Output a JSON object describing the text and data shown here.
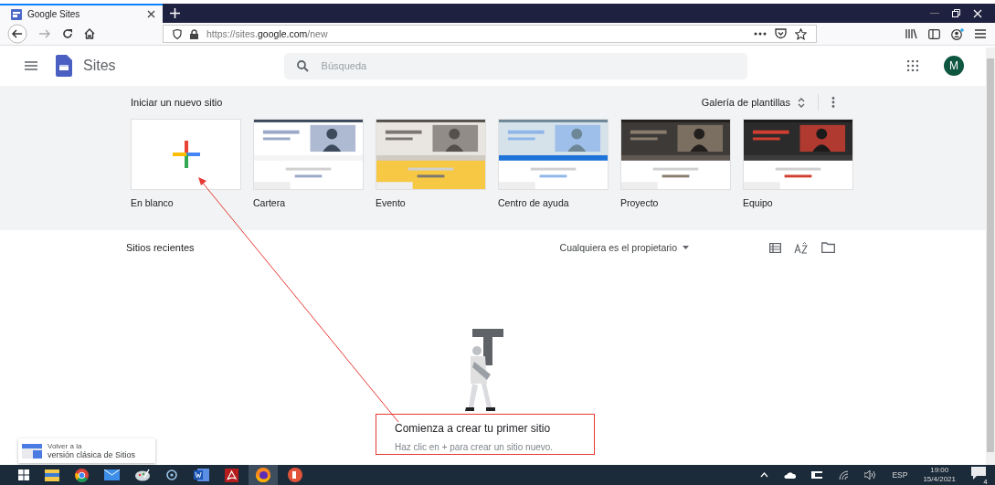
{
  "browser": {
    "tabs": [
      {
        "title": "Google Sites",
        "selected": true
      }
    ],
    "url": "https://sites.**google.com**/new"
  },
  "app": {
    "name": "Sites",
    "search_placeholder": "Búsqueda",
    "avatar": "M"
  },
  "gallery": {
    "heading": "Iniciar un nuevo sitio",
    "toggle": "Galería de plantillas",
    "templates": [
      {
        "name": "En blanco",
        "kind": "blank"
      },
      {
        "name": "Cartera",
        "kind": "picture"
      },
      {
        "name": "Evento",
        "kind": "picture"
      },
      {
        "name": "Centro de ayuda",
        "kind": "picture"
      },
      {
        "name": "Proyecto",
        "kind": "picture"
      },
      {
        "name": "Equipo",
        "kind": "picture"
      }
    ]
  },
  "recent": {
    "heading": "Sitios recientes",
    "owner_filter": "Cualquiera es el propietario"
  },
  "empty_state": {
    "title": "Comienza a crear tu primer sitio",
    "hint": "Haz clic en + para crear un sitio nuevo."
  },
  "classic_link": {
    "line1": "Volver a la",
    "line2": "versión clásica de Sitios"
  },
  "taskbar": {
    "language": "ESP",
    "time": "19:00",
    "date": "15/4/2021",
    "notifications": "4"
  }
}
